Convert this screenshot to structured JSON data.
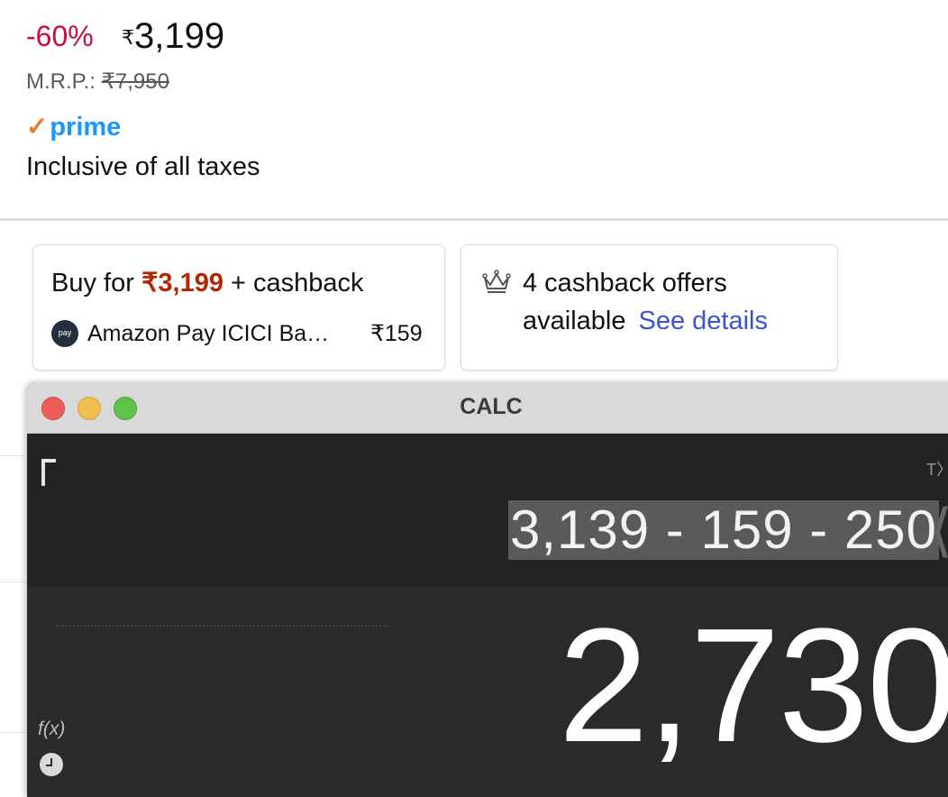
{
  "product": {
    "discount": "-60%",
    "price_symbol": "₹",
    "price": "3,199",
    "mrp_label": "M.R.P.:",
    "mrp_value": "₹7,950",
    "prime_label": "prime",
    "taxes_note": "Inclusive of all taxes"
  },
  "offers": {
    "buy_prefix": "Buy for",
    "buy_price": "₹3,199",
    "buy_suffix": "+ cashback",
    "pay_badge": "pay",
    "pay_name": "Amazon Pay ICICI Ba…",
    "pay_amount": "₹159",
    "cashback_line1": "4 cashback offers",
    "cashback_line2": "available",
    "see_details": "See details"
  },
  "calc": {
    "title": "CALC",
    "tx_label": "T〉",
    "expression": "3,139 - 159 - 250",
    "result": "2,730",
    "fx_label": "f(x)"
  },
  "colors": {
    "discount_red": "#cc0c39",
    "prime_blue": "#1a98ff",
    "link_blue": "#3b52d1",
    "price_red": "#b12704"
  }
}
